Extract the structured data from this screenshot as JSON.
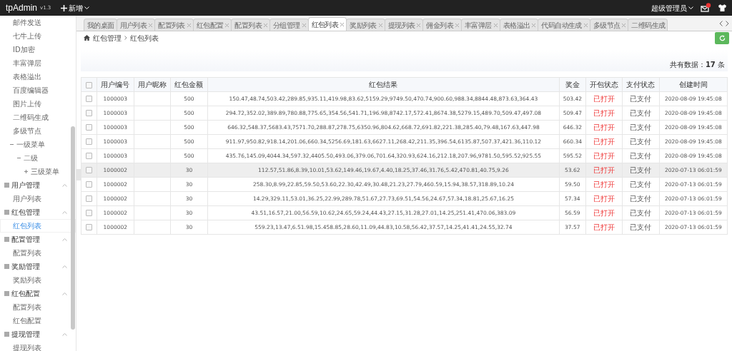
{
  "topbar": {
    "brand": "tpAdmin",
    "version": "v1.3",
    "add_menu": "新增",
    "user": "超级管理员",
    "mail_badge": true
  },
  "sidebar": {
    "items": [
      {
        "label": "邮件发送",
        "selected": false
      },
      {
        "label": "七牛上传",
        "selected": false
      },
      {
        "label": "ID加密",
        "selected": false
      },
      {
        "label": "丰富弹层",
        "selected": false
      },
      {
        "label": "表格溢出",
        "selected": false
      },
      {
        "label": "百度编辑器",
        "selected": false
      },
      {
        "label": "图片上传",
        "selected": false
      },
      {
        "label": "二维码生成",
        "selected": false
      },
      {
        "label": "多级节点",
        "selected": false
      },
      {
        "label": "一级菜单",
        "expanded": true,
        "children": [
          {
            "label": "二级",
            "expanded": true,
            "children": [
              {
                "label": "三级菜单",
                "expanded": false
              }
            ]
          }
        ]
      }
    ],
    "groups": [
      {
        "label": "用户管理",
        "expanded": true,
        "items": [
          {
            "label": "用户列表",
            "selected": false
          }
        ]
      },
      {
        "label": "红包管理",
        "expanded": true,
        "items": [
          {
            "label": "红包列表",
            "selected": true
          }
        ]
      },
      {
        "label": "配置管理",
        "expanded": true,
        "items": [
          {
            "label": "配置列表",
            "selected": false
          }
        ]
      },
      {
        "label": "奖励管理",
        "expanded": true,
        "items": [
          {
            "label": "奖励列表",
            "selected": false
          }
        ]
      },
      {
        "label": "红包配置",
        "expanded": true,
        "items": [
          {
            "label": "配置列表",
            "selected": false
          },
          {
            "label": "红包配置",
            "selected": false
          }
        ]
      },
      {
        "label": "提现管理",
        "expanded": true,
        "items": [
          {
            "label": "提现列表",
            "selected": false
          }
        ]
      }
    ]
  },
  "tabs": [
    {
      "label": "我的桌面",
      "selected": false,
      "closable": false
    },
    {
      "label": "用户列表",
      "selected": false,
      "closable": true
    },
    {
      "label": "配置列表",
      "selected": false,
      "closable": true
    },
    {
      "label": "红包配置",
      "selected": false,
      "closable": true
    },
    {
      "label": "配置列表",
      "selected": false,
      "closable": true
    },
    {
      "label": "分组管理",
      "selected": false,
      "closable": true
    },
    {
      "label": "红包列表",
      "selected": true,
      "closable": true
    },
    {
      "label": "奖励列表",
      "selected": false,
      "closable": true
    },
    {
      "label": "提现列表",
      "selected": false,
      "closable": true
    },
    {
      "label": "佣金列表",
      "selected": false,
      "closable": true
    },
    {
      "label": "丰富弹层",
      "selected": false,
      "closable": true
    },
    {
      "label": "表格溢出",
      "selected": false,
      "closable": true
    },
    {
      "label": "代码自动生成",
      "selected": false,
      "closable": true
    },
    {
      "label": "多级节点",
      "selected": false,
      "closable": true
    },
    {
      "label": "二维码生成",
      "selected": false,
      "closable": false
    }
  ],
  "breadcrumb": [
    "红包管理",
    "红包列表"
  ],
  "count": "共有数据：**17** 条",
  "table": {
    "select_all": false,
    "columns": [
      "用户编号",
      "用户昵称",
      "红包金额",
      "红包结果",
      "奖金",
      "开包状态",
      "支付状态",
      "创建时间"
    ],
    "rows": [
      {
        "checked": false,
        "highlighted": false,
        "cells": [
          "1000003",
          "",
          "500",
          "150.47,48.74,503.42,289.85,935.11,419.98,83.62,5159.29,9749.50,470.74,900.60,988.34,8844.48,873.63,364.43",
          "503.42",
          "已打开",
          "已支付",
          "2020-08-09 19:45:08"
        ]
      },
      {
        "checked": false,
        "highlighted": false,
        "cells": [
          "1000003",
          "",
          "500",
          "294.72,352.02,389.89,780.88,775.65,354.56,541.71,196.98,8742.17,572.41,8674.38,5279.15,489.70,509.47,497.08",
          "509.47",
          "已打开",
          "已支付",
          "2020-08-09 19:45:08"
        ]
      },
      {
        "checked": false,
        "highlighted": false,
        "cells": [
          "1000003",
          "",
          "500",
          "646.32,548.37,5683.43,7571.70,288.87,278.75,6350.96,804.62,668.72,691.82,221.38,285.40,79.48,167.63,447.98",
          "646.32",
          "已打开",
          "已支付",
          "2020-08-09 19:45:08"
        ]
      },
      {
        "checked": false,
        "highlighted": false,
        "cells": [
          "1000003",
          "",
          "500",
          "911.97,950.82,918.14,201.06,660.34,5256.69,181.63,6627.11,268.42,211.35,396.54,6135.87,507.37,421.36,110.12",
          "660.34",
          "已打开",
          "已支付",
          "2020-08-09 19:45:08"
        ]
      },
      {
        "checked": false,
        "highlighted": false,
        "cells": [
          "1000003",
          "",
          "500",
          "435.76,145.09,4044.34,597.32,4405.50,493.06,379.06,701.64,320.93,624.16,212.18,207.96,9781.50,595.52,925.55",
          "595.52",
          "已打开",
          "已支付",
          "2020-08-09 19:45:08"
        ]
      },
      {
        "checked": false,
        "highlighted": true,
        "cells": [
          "1000002",
          "",
          "30",
          "112.57,51.86,8.39,10.01,53.62,149.46,19.67,4.40,18.25,37.46,31.76,5.42,470.81,40.75,9.26",
          "53.62",
          "已打开",
          "已支付",
          "2020-07-13 06:01:59"
        ]
      },
      {
        "checked": false,
        "highlighted": false,
        "cells": [
          "1000002",
          "",
          "30",
          "258.30,8.99,22.85,59.50,53.60,22.30,42.49,30.48,21.23,27.79,460.59,15.94,38.57,318.89,10.24",
          "59.50",
          "已打开",
          "已支付",
          "2020-07-13 06:01:59"
        ]
      },
      {
        "checked": false,
        "highlighted": false,
        "cells": [
          "1000002",
          "",
          "30",
          "14.29,329.11,53.01,36.25,22.99,289.78,51.67,27.73,69.51,54.56,24.67,57.34,18.81,25.67,16.25",
          "57.34",
          "已打开",
          "已支付",
          "2020-07-13 06:01:59"
        ]
      },
      {
        "checked": false,
        "highlighted": false,
        "cells": [
          "1000002",
          "",
          "30",
          "43.51,16.57,21.00,56.59,10.62,24.65,59.24,44.43,27.15,31.28,27.01,14.25,251.41,470.06,383.09",
          "56.59",
          "已打开",
          "已支付",
          "2020-07-13 06:01:59"
        ]
      },
      {
        "checked": false,
        "highlighted": false,
        "cells": [
          "1000002",
          "",
          "30",
          "559.23,13.47,6.51.98,15.458.85,28.60,11.09,44.83,10.58,56.42,37.57,14.25,41.41,24.55,32.74",
          "37.57",
          "已打开",
          "已支付",
          "2020-07-13 06:01:59"
        ]
      }
    ]
  }
}
